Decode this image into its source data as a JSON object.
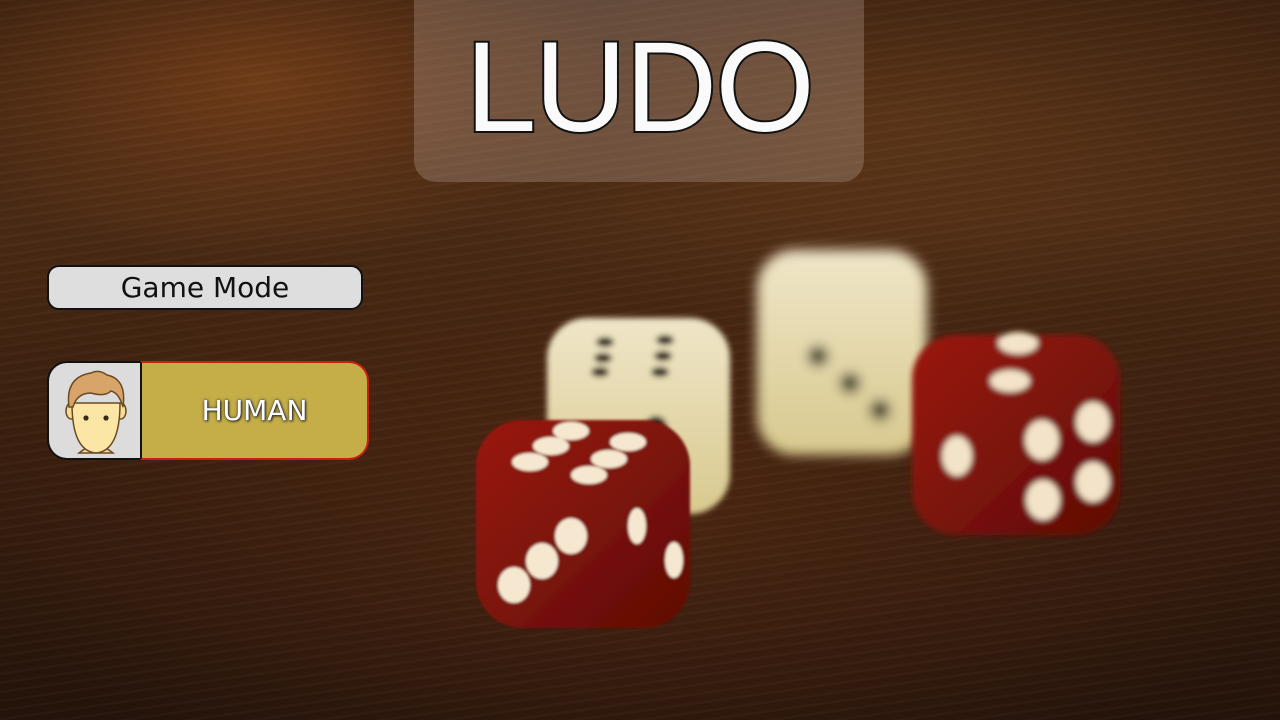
{
  "game": {
    "title": "LUDO",
    "mode_label": "Game Mode",
    "player_mode": "HUMAN",
    "avatar_icon": "human-face-icon"
  },
  "colors": {
    "mode_button": "#c5ad48",
    "mode_button_border": "#c81e14",
    "label_bg": "#dedede"
  }
}
